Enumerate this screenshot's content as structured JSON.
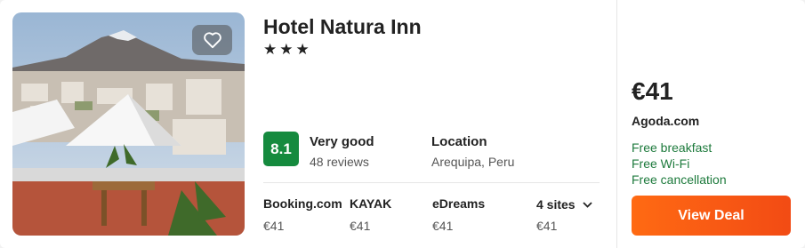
{
  "hotel": {
    "name": "Hotel Natura Inn",
    "stars": "★★★"
  },
  "rating": {
    "score": "8.1",
    "label": "Very good",
    "reviews": "48 reviews"
  },
  "location": {
    "label": "Location",
    "value": "Arequipa, Peru"
  },
  "sites": [
    {
      "name": "Booking.com",
      "price": "€41"
    },
    {
      "name": "KAYAK",
      "price": "€41"
    },
    {
      "name": "eDreams",
      "price": "€41"
    },
    {
      "name": "4 sites",
      "price": "€41"
    }
  ],
  "deal": {
    "price": "€41",
    "provider": "Agoda.com",
    "perks": [
      "Free breakfast",
      "Free Wi-Fi",
      "Free cancellation"
    ],
    "button_label": "View Deal"
  },
  "icons": {
    "favorite": "heart-outline-icon",
    "more_sites": "chevron-down-icon"
  },
  "colors": {
    "rating_badge": "#158a3e",
    "perk_text": "#1d7a3c",
    "deal_button": "#f55a14"
  }
}
